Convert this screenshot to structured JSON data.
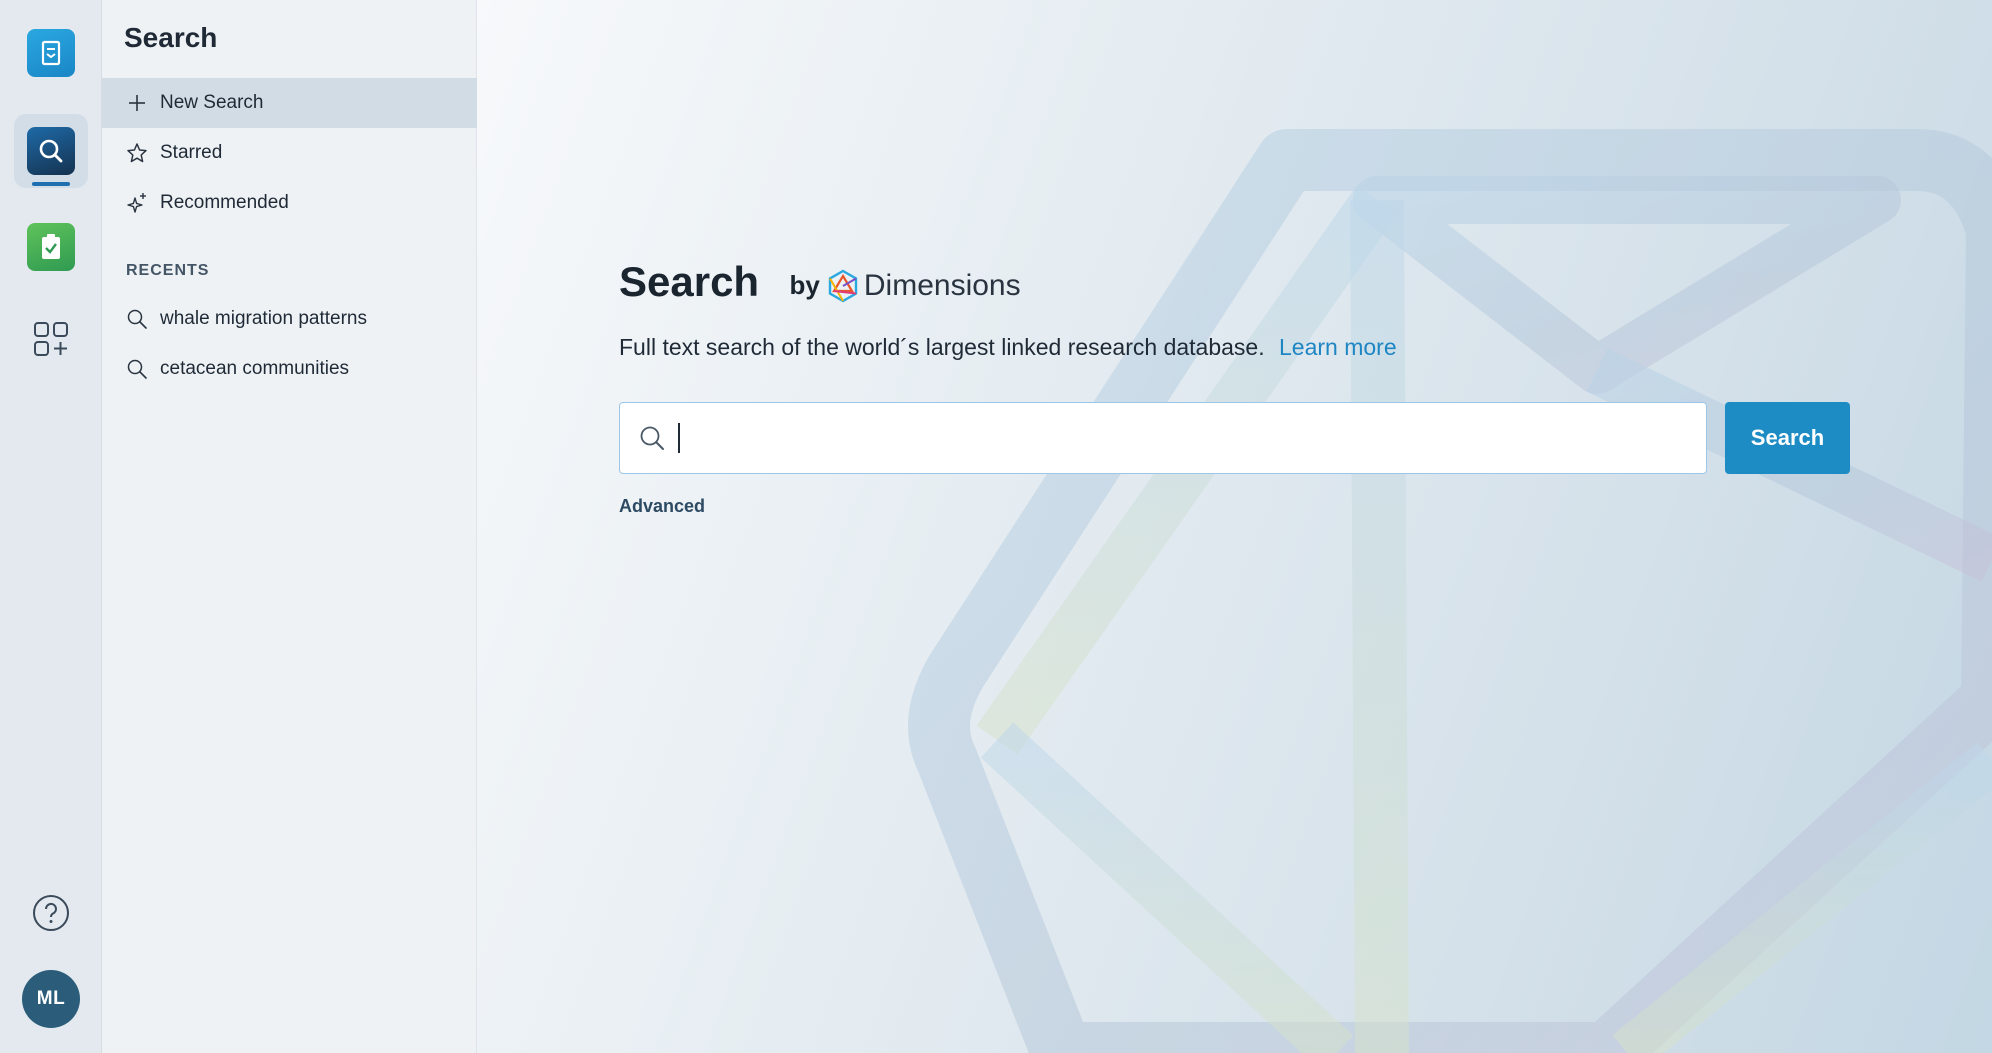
{
  "rail": {
    "apps": [
      {
        "name": "library-app"
      },
      {
        "name": "search-app",
        "active": true
      },
      {
        "name": "tasks-app"
      },
      {
        "name": "add-apps"
      }
    ],
    "avatar_initials": "ML"
  },
  "sidebar": {
    "title": "Search",
    "items": [
      {
        "label": "New Search",
        "icon": "plus-icon",
        "selected": true
      },
      {
        "label": "Starred",
        "icon": "star-icon"
      },
      {
        "label": "Recommended",
        "icon": "sparkle-icon"
      }
    ],
    "recents_label": "RECENTS",
    "recents": [
      {
        "label": "whale migration patterns",
        "icon": "search-icon"
      },
      {
        "label": "cetacean communities",
        "icon": "search-icon"
      }
    ]
  },
  "main": {
    "title": "Search",
    "by": "by",
    "brand": "Dimensions",
    "description": "Full text search of the world´s largest linked research database.",
    "learn_more": "Learn more",
    "search_value": "",
    "search_button": "Search",
    "advanced": "Advanced"
  },
  "colors": {
    "accent": "#1e8cc4",
    "link": "#1f86c4",
    "avatar": "#2b5d7a"
  }
}
